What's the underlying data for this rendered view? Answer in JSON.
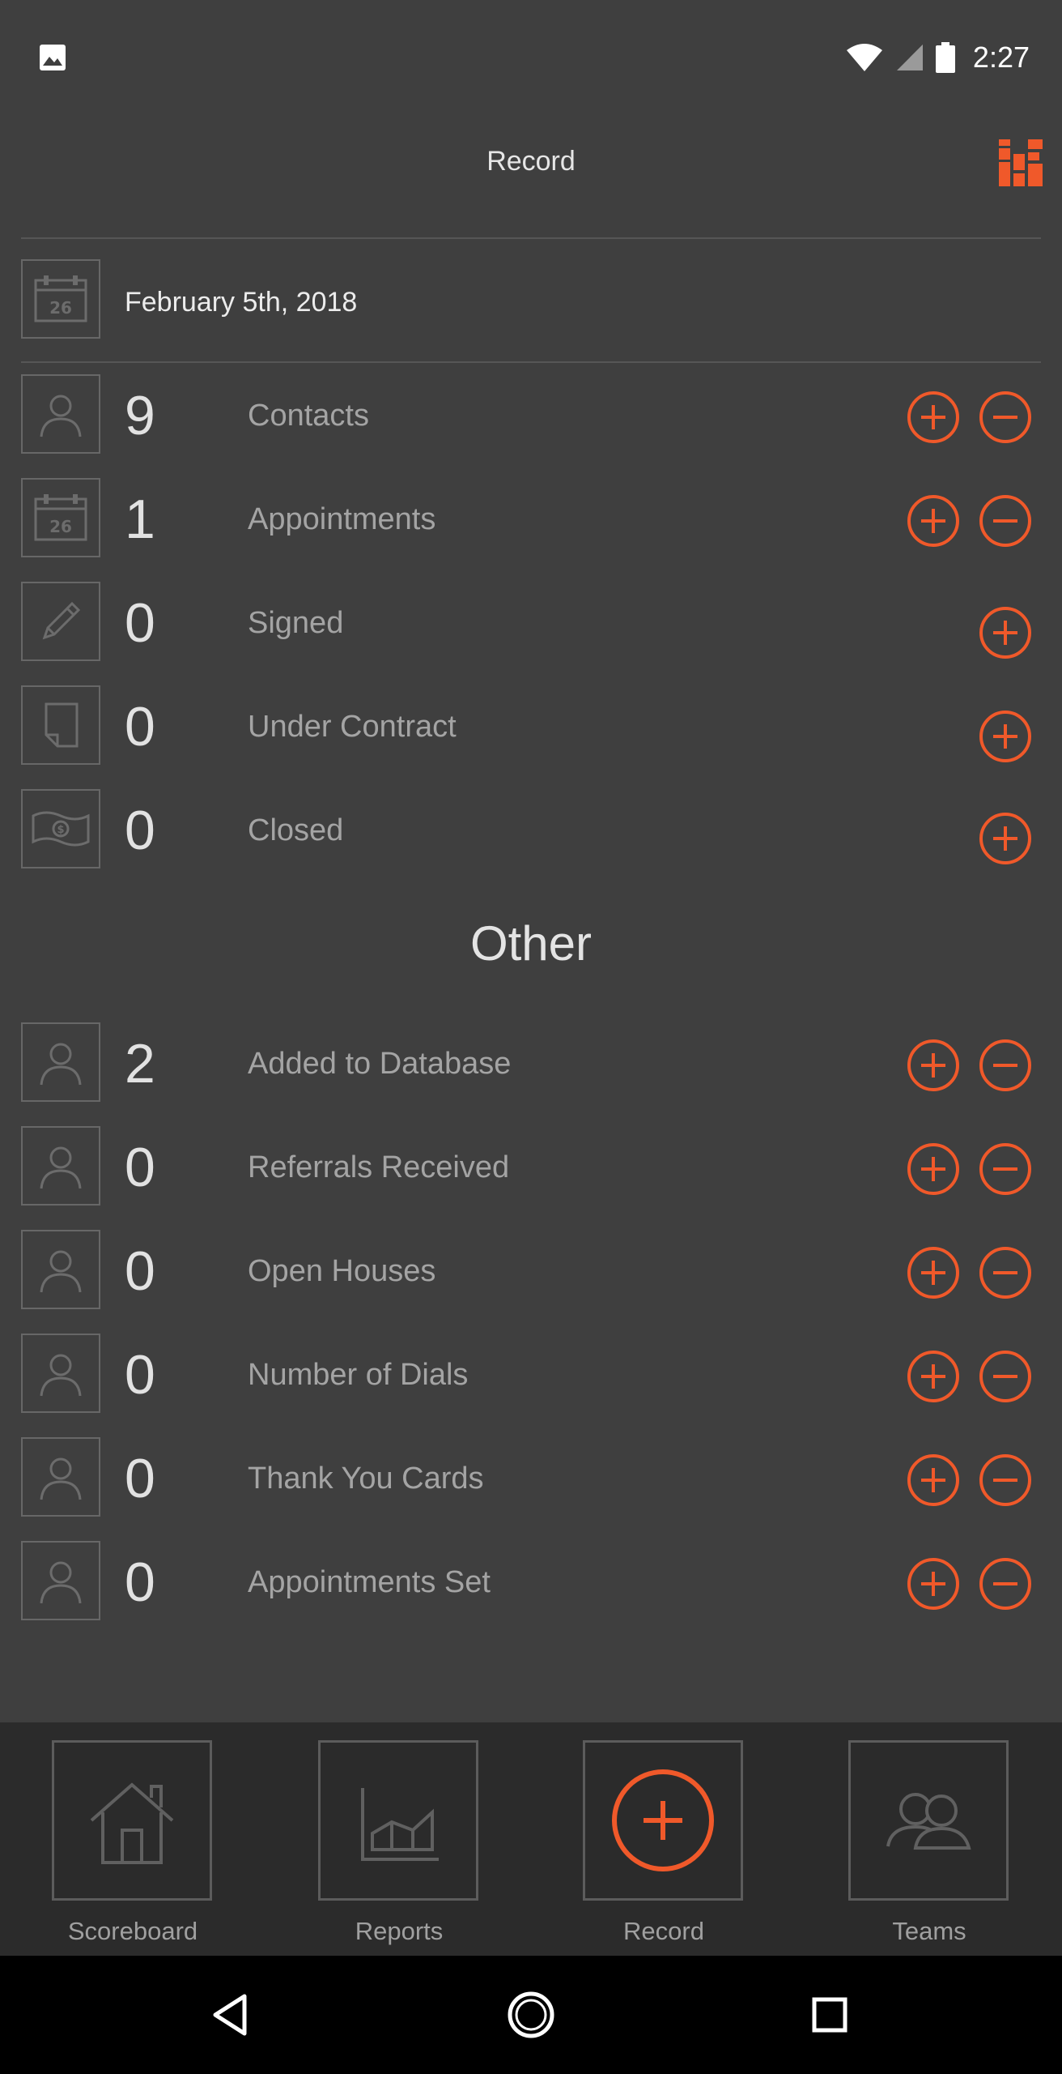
{
  "status_bar": {
    "time": "2:27"
  },
  "header": {
    "title": "Record"
  },
  "date": {
    "text": "February 5th, 2018",
    "icon_number": "26"
  },
  "primary_rows": [
    {
      "label": "Contacts",
      "count": "9",
      "icon": "person-icon",
      "has_minus": true
    },
    {
      "label": "Appointments",
      "count": "1",
      "icon": "calendar-icon",
      "has_minus": true
    },
    {
      "label": "Signed",
      "count": "0",
      "icon": "pencil-icon",
      "has_minus": false
    },
    {
      "label": "Under Contract",
      "count": "0",
      "icon": "document-icon",
      "has_minus": false
    },
    {
      "label": "Closed",
      "count": "0",
      "icon": "money-icon",
      "has_minus": false
    }
  ],
  "other_section": {
    "title": "Other",
    "rows": [
      {
        "label": "Added to Database",
        "count": "2",
        "icon": "person-icon"
      },
      {
        "label": "Referrals Received",
        "count": "0",
        "icon": "person-icon"
      },
      {
        "label": "Open Houses",
        "count": "0",
        "icon": "person-icon"
      },
      {
        "label": "Number of Dials",
        "count": "0",
        "icon": "person-icon"
      },
      {
        "label": "Thank You Cards",
        "count": "0",
        "icon": "person-icon"
      },
      {
        "label": "Appointments Set",
        "count": "0",
        "icon": "person-icon"
      }
    ]
  },
  "tabs": [
    {
      "label": "Scoreboard",
      "icon": "home-icon"
    },
    {
      "label": "Reports",
      "icon": "chart-icon"
    },
    {
      "label": "Record",
      "icon": "plus-circle-icon",
      "active": true
    },
    {
      "label": "Teams",
      "icon": "team-icon"
    }
  ],
  "colors": {
    "accent": "#f0592a",
    "background": "#3f3f3f",
    "tabbar": "#2b2b2b"
  }
}
